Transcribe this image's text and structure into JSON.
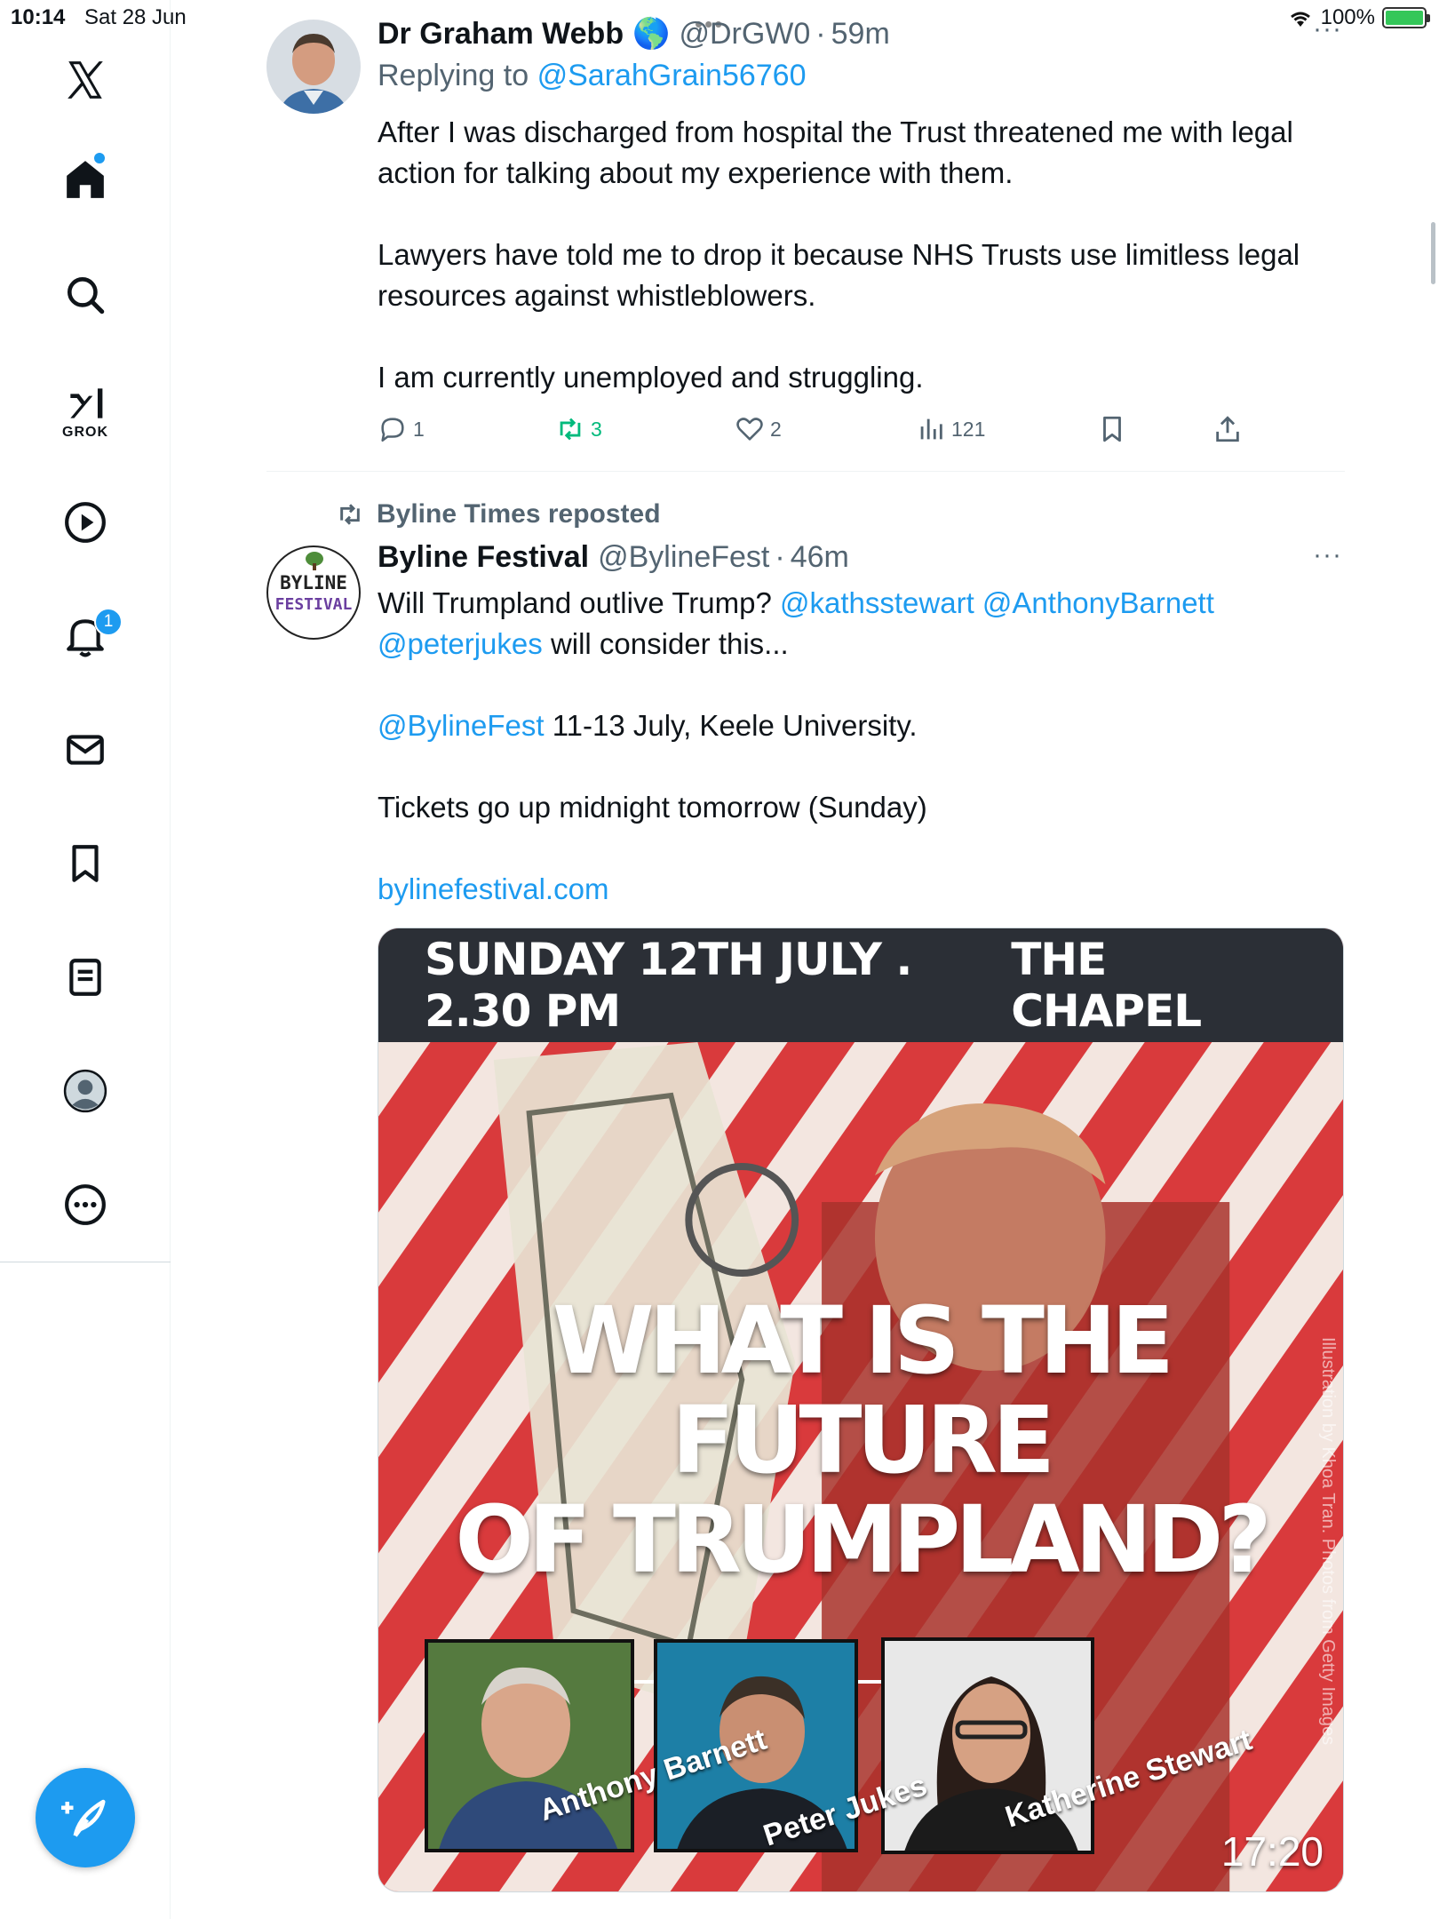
{
  "status_bar": {
    "time": "10:14",
    "date": "Sat 28 Jun",
    "battery": "100%"
  },
  "sidebar": {
    "items": [
      {
        "label": "X"
      },
      {
        "label": "Home"
      },
      {
        "label": "Search"
      },
      {
        "label": "GROK"
      },
      {
        "label": "Videos"
      },
      {
        "label": "Notifications",
        "badge": "1"
      },
      {
        "label": "Messages"
      },
      {
        "label": "Bookmarks"
      },
      {
        "label": "Lists"
      },
      {
        "label": "Profile"
      },
      {
        "label": "More"
      }
    ],
    "compose_label": "Post"
  },
  "tweets": [
    {
      "name": "Dr Graham Webb",
      "emoji": "🌎",
      "handle": "@DrGW0",
      "time": "59m",
      "reply_prefix": "Replying to",
      "reply_handle": "@SarahGrain56760",
      "paragraphs": [
        "After I was discharged from hospital the Trust threatened me with legal action for talking about my experience with them.",
        "Lawyers have told me to drop it because NHS Trusts use limitless legal resources against whistleblowers.",
        "I am currently unemployed and struggling."
      ],
      "stats": {
        "replies": "1",
        "reposts": "3",
        "likes": "2",
        "views": "121"
      }
    },
    {
      "reposted_by": "Byline Times reposted",
      "name": "Byline Festival",
      "handle": "@BylineFest",
      "time": "46m",
      "line1_text": "Will Trumpland outlive Trump?",
      "line1_mentions": "@kathsstewart @AnthonyBarnett",
      "line2_mention": "@peterjukes",
      "line2_text": "will consider this...",
      "p2_mention": "@BylineFest",
      "p2_text": "11-13 July, Keele University.",
      "p3": "Tickets go up midnight tomorrow (Sunday)",
      "url": "bylinefestival.com",
      "avatar_text_1": "BYLINE",
      "avatar_text_2": "FESTIVAL"
    }
  ],
  "media": {
    "banner_left": "SUNDAY 12TH JULY . 2.30 PM",
    "banner_right": "THE CHAPEL",
    "headline_line1": "WHAT IS THE FUTURE",
    "headline_line2": "OF TRUMPLAND?",
    "speakers": [
      "Anthony Barnett",
      "Peter Jukes",
      "Katherine Stewart"
    ],
    "credit": "Illustration by Khoa Tran. Photos from Getty Images",
    "duration": "17:20"
  }
}
